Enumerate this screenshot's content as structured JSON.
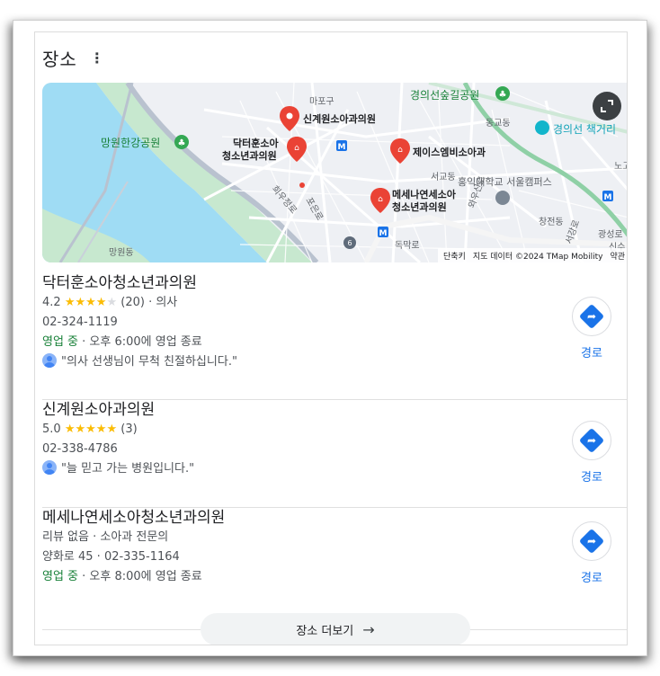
{
  "header": {
    "title": "장소",
    "menu_icon": "more-vert-icon"
  },
  "map": {
    "labels": {
      "mapo": "마포구",
      "park1": "경의선숲길공원",
      "park2": "망원한강공원",
      "station": "경의선 책거리",
      "donggyo": "동교동",
      "seogyo": "서교동",
      "univ": "홍익대학교 서울캠퍼스",
      "changjeon": "창전동",
      "gwangsan": "광성로",
      "mangwon": "망원동",
      "dongmak": "독막로",
      "road1": "희우정로",
      "road2": "포은로",
      "road3": "와우산로",
      "road4": "서강로",
      "changcheon": "창",
      "nogo": "노고",
      "sinsu": "신수",
      "route6": "6"
    },
    "pins": [
      {
        "line1": "신계원소아과의원",
        "line2": ""
      },
      {
        "line1": "닥터훈소아",
        "line2": "청소년과의원"
      },
      {
        "line1": "제이스엠비소아과",
        "line2": ""
      },
      {
        "line1": "메세나연세소아",
        "line2": "청소년과의원"
      }
    ],
    "footer": {
      "shortcuts": "단축키",
      "data": "지도 데이터 ©2024 TMap Mobility",
      "terms": "약관"
    },
    "expand_icon": "fullscreen-icon"
  },
  "places": [
    {
      "name": "닥터훈소아청소년과의원",
      "rating": "4.2",
      "stars_full": "★★★★",
      "stars_empty": "★",
      "reviews": "(20)",
      "category": " · 의사",
      "phone": "02-324-1119",
      "status": "영업 중",
      "hours": " · 오후 6:00에 영업 종료",
      "review": "\"의사 선생님이 무척 친절하십니다.\"",
      "route_label": "경로"
    },
    {
      "name": "신계원소아과의원",
      "rating": "5.0",
      "stars_full": "★★★★★",
      "stars_empty": "",
      "reviews": "(3)",
      "phone": "02-338-4786",
      "review": "\"늘 믿고 가는 병원입니다.\"",
      "route_label": "경로"
    },
    {
      "name": "메세나연세소아청소년과의원",
      "meta": "리뷰 없음 · 소아과 전문의",
      "address": "양화로 45 · 02-335-1164",
      "status": "영업 중",
      "hours": " · 오후 8:00에 영업 종료",
      "route_label": "경로"
    }
  ],
  "more_button": {
    "label": "장소 더보기",
    "icon": "arrow-right-icon"
  },
  "colors": {
    "accent": "#1a73e8",
    "open": "#188038",
    "star": "#fbbc04",
    "pin": "#ea4335",
    "water": "#9fdcf4",
    "park": "#c7e8cf"
  }
}
